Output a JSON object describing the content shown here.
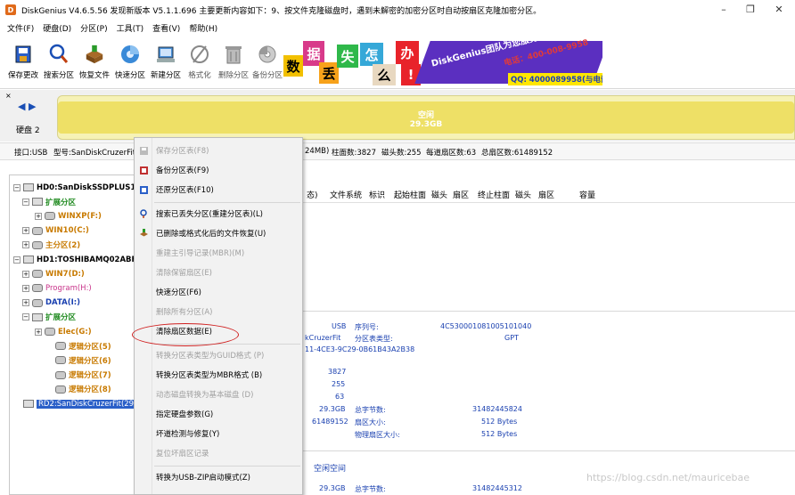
{
  "window": {
    "title": "DiskGenius V4.6.5.56   发现新版本 V5.1.1.696 主要更新内容如下：9、按文件克隆磁盘时，遇到未解密的加密分区时自动按扇区克隆加密分区。",
    "app_icon_letter": "D",
    "minimize": "–",
    "restore": "❐",
    "close": "✕"
  },
  "menubar": [
    "文件(F)",
    "硬盘(D)",
    "分区(P)",
    "工具(T)",
    "查看(V)",
    "帮助(H)"
  ],
  "toolbar": [
    {
      "label": "保存更改",
      "icon": "save-icon"
    },
    {
      "label": "搜索分区",
      "icon": "search-icon"
    },
    {
      "label": "恢复文件",
      "icon": "recover-icon"
    },
    {
      "label": "快速分区",
      "icon": "quick-partition-icon"
    },
    {
      "label": "新建分区",
      "icon": "new-partition-icon"
    },
    {
      "label": "格式化",
      "icon": "format-icon"
    },
    {
      "label": "删除分区",
      "icon": "delete-icon"
    },
    {
      "label": "备份分区",
      "icon": "backup-icon"
    }
  ],
  "banner": {
    "tiles": [
      "数",
      "据",
      "丢",
      "失",
      "怎",
      "么",
      "办",
      "!"
    ],
    "slogan": "DiskGenius团队为您服务",
    "tel": "电话：400-008-9958",
    "qq": "QQ: 4000089958(与电话同号)"
  },
  "diskbar": {
    "close": "×",
    "arrows": "◀ ▶",
    "disk_label": "硬盘 2",
    "partition_name": "空闲",
    "partition_size": "29.3GB"
  },
  "infoline": {
    "interface": "接口:USB",
    "model": "型号:SanDiskCruzerFit",
    "capacity_tail": "24MB)",
    "cylinders": "柱面数:3827",
    "heads": "磁头数:255",
    "sectors_per_track": "每道扇区数:63",
    "total_sectors": "总扇区数:61489152"
  },
  "tree": [
    {
      "text": "HD0:SanDiskSSDPLUS120GB",
      "level": 0,
      "style": "dark",
      "exp": "−",
      "icon": "disk"
    },
    {
      "text": "扩展分区",
      "level": 1,
      "style": "green",
      "exp": "−",
      "icon": "disk"
    },
    {
      "text": "WINXP(F:)",
      "level": 2,
      "style": "orange",
      "exp": "+",
      "icon": "part"
    },
    {
      "text": "WIN10(C:)",
      "level": 1,
      "style": "orange",
      "exp": "+",
      "icon": "part"
    },
    {
      "text": "主分区(2)",
      "level": 1,
      "style": "orange",
      "exp": "+",
      "icon": "part"
    },
    {
      "text": "HD1:TOSHIBAMQ02ABF100(9",
      "level": 0,
      "style": "dark",
      "exp": "−",
      "icon": "disk"
    },
    {
      "text": "WIN7(D:)",
      "level": 1,
      "style": "orange",
      "exp": "+",
      "icon": "part"
    },
    {
      "text": "Program(H:)",
      "level": 1,
      "style": "pink",
      "exp": "+",
      "icon": "part"
    },
    {
      "text": "DATA(I:)",
      "level": 1,
      "style": "blue",
      "exp": "+",
      "icon": "part"
    },
    {
      "text": "扩展分区",
      "level": 1,
      "style": "green",
      "exp": "−",
      "icon": "disk"
    },
    {
      "text": "Elec(G:)",
      "level": 2,
      "style": "orange",
      "exp": "+",
      "icon": "part"
    },
    {
      "text": "逻辑分区(5)",
      "level": 3,
      "style": "orange",
      "exp": "",
      "icon": "part"
    },
    {
      "text": "逻辑分区(6)",
      "level": 3,
      "style": "orange",
      "exp": "",
      "icon": "part"
    },
    {
      "text": "逻辑分区(7)",
      "level": 3,
      "style": "orange",
      "exp": "",
      "icon": "part"
    },
    {
      "text": "逻辑分区(8)",
      "level": 3,
      "style": "orange",
      "exp": "",
      "icon": "part"
    },
    {
      "text": "RD2:SanDiskCruzerFit(29",
      "level": 0,
      "style": "sel",
      "exp": "",
      "icon": "disk"
    }
  ],
  "columns": [
    "态)",
    "文件系统",
    "标识",
    "起始柱面",
    "磁头",
    "扇区",
    "终止柱面",
    "磁头",
    "扇区",
    "容量"
  ],
  "details": {
    "usb": "USB",
    "model_tail": "kCruzerFit",
    "guid": "11-4CE3-9C29-0B61B43A2B38",
    "serial_label": "序列号:",
    "serial_value": "4C530001081005101040",
    "pt_type_label": "分区表类型:",
    "pt_type_value": "GPT",
    "cyl": "3827",
    "heads": "255",
    "spt": "63",
    "cap": "29.3GB",
    "total_bytes_label": "总字节数:",
    "total_bytes_value": "31482445824",
    "sector_size_label": "扇区大小:",
    "sector_size_value": "512 Bytes",
    "total_sectors": "61489152",
    "phys_sector_label": "物理扇区大小:",
    "phys_sector_value": "512 Bytes",
    "free_title": "空闲空间",
    "free_cap": "29.3GB",
    "free_bytes_label": "总字节数:",
    "free_bytes_value": "31482445312"
  },
  "context_menu": [
    {
      "label": "保存分区表(F8)",
      "disabled": true,
      "icon": "save-table-icon"
    },
    {
      "label": "备份分区表(F9)",
      "disabled": false,
      "icon": "backup-table-icon"
    },
    {
      "label": "还原分区表(F10)",
      "disabled": false,
      "icon": "restore-table-icon"
    },
    {
      "sep": true
    },
    {
      "label": "搜索已丢失分区(重建分区表)(L)",
      "disabled": false,
      "icon": "search-lost-icon"
    },
    {
      "label": "已删除或格式化后的文件恢复(U)",
      "disabled": false,
      "icon": "file-recover-icon"
    },
    {
      "label": "重建主引导记录(MBR)(M)",
      "disabled": true,
      "icon": ""
    },
    {
      "label": "清除保留扇区(E)",
      "disabled": true,
      "icon": ""
    },
    {
      "label": "快速分区(F6)",
      "disabled": false,
      "icon": ""
    },
    {
      "label": "删除所有分区(A)",
      "disabled": true,
      "icon": ""
    },
    {
      "label": "清除扇区数据(E)",
      "disabled": false,
      "icon": ""
    },
    {
      "sep": true
    },
    {
      "label": "转换分区表类型为GUID格式 (P)",
      "disabled": true,
      "icon": ""
    },
    {
      "label": "转换分区表类型为MBR格式 (B)",
      "disabled": false,
      "icon": ""
    },
    {
      "label": "动态磁盘转换为基本磁盘 (D)",
      "disabled": true,
      "icon": ""
    },
    {
      "label": "指定硬盘参数(G)",
      "disabled": false,
      "icon": ""
    },
    {
      "label": "坏道检测与修复(Y)",
      "disabled": false,
      "icon": ""
    },
    {
      "label": "复位坏扇区记录",
      "disabled": true,
      "icon": ""
    },
    {
      "sep": true
    },
    {
      "label": "转换为USB-ZIP启动模式(Z)",
      "disabled": false,
      "icon": ""
    }
  ],
  "watermark": "https://blog.csdn.net/mauricebae"
}
